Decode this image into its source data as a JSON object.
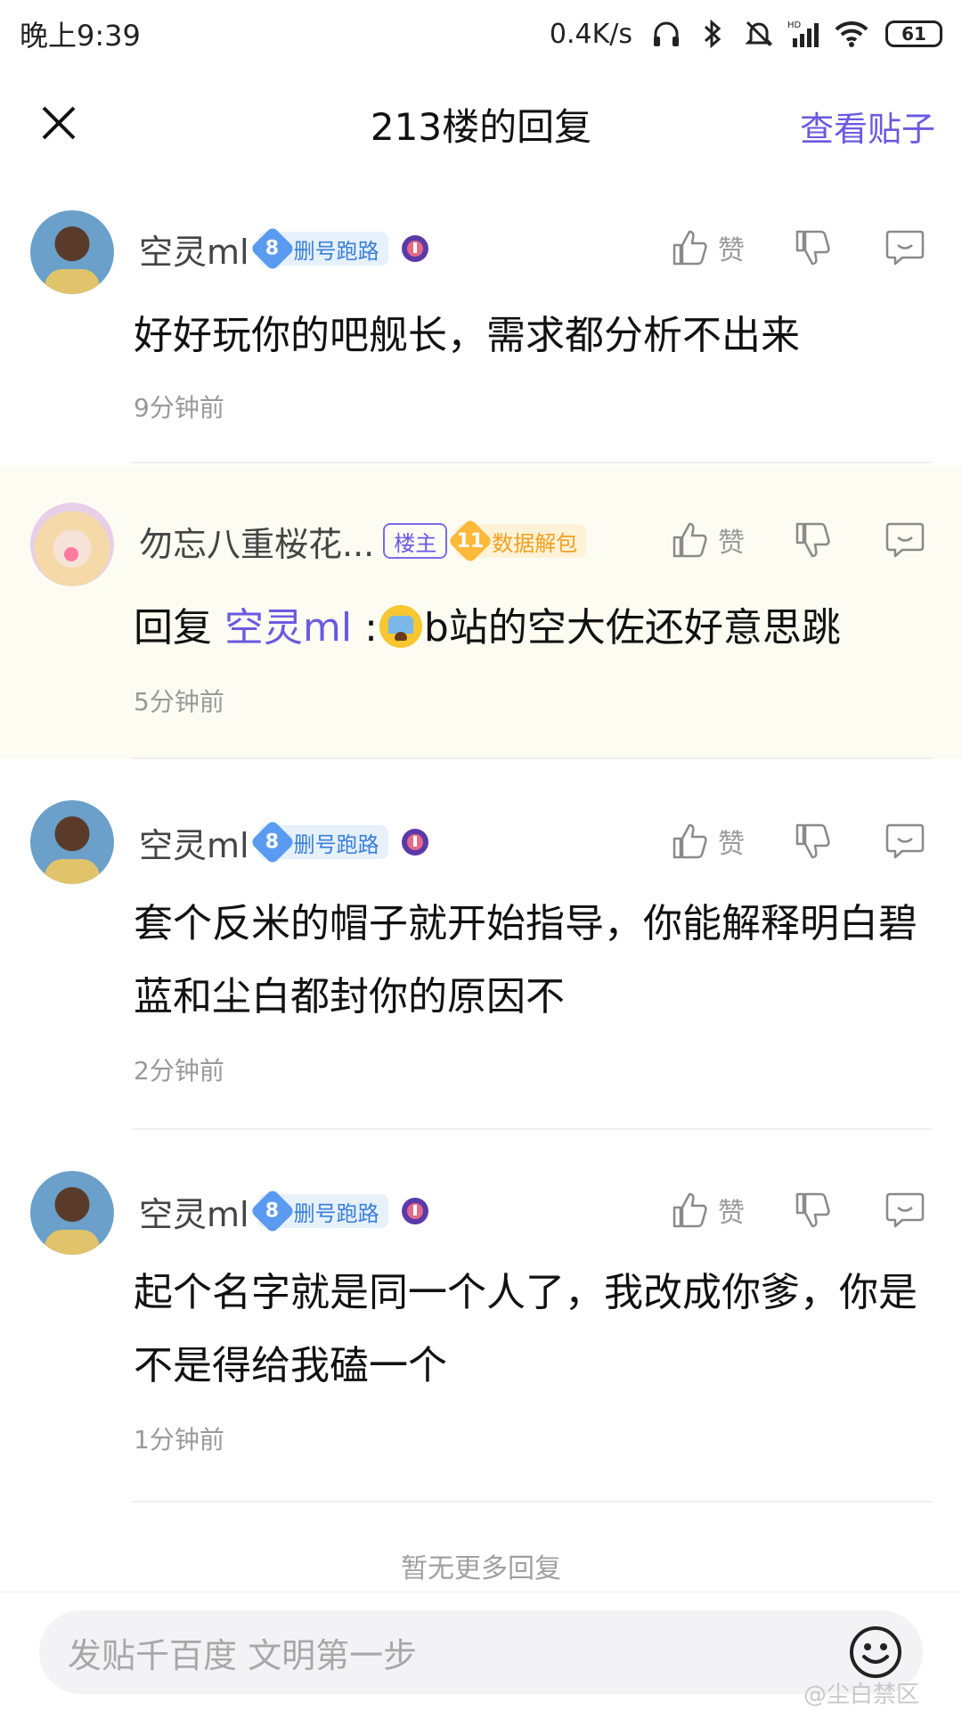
{
  "status_bar": {
    "time": "晚上9:39",
    "net_speed": "0.4K/s",
    "battery": "61",
    "icons": [
      "headphones-icon",
      "bluetooth-icon",
      "mute-icon",
      "hd-signal-icon",
      "wifi-icon",
      "battery-icon"
    ]
  },
  "header": {
    "title": "213楼的回复",
    "link": "查看贴子",
    "close_icon": "close-icon"
  },
  "colors": {
    "accent": "#6a5ae0",
    "level_blue": "#5a9af1",
    "level_gold": "#ffb93a",
    "highlight_bg": "#fdfcf3"
  },
  "replies": [
    {
      "username": "空灵ml",
      "level": "8",
      "badge": "删号跑路",
      "content": "好好玩你的吧舰长，需求都分析不出来",
      "time": "9分钟前",
      "like_label": "赞"
    },
    {
      "username": "勿忘八重桜花...",
      "owner_tag": "楼主",
      "level": "11",
      "badge": "数据解包",
      "reply_prefix": "回复 ",
      "mention": "空灵ml",
      "content_after": " :",
      "content_rest": "b站的空大佐还好意思跳",
      "time": "5分钟前",
      "like_label": "赞"
    },
    {
      "username": "空灵ml",
      "level": "8",
      "badge": "删号跑路",
      "content": "套个反米的帽子就开始指导，你能解释明白碧蓝和尘白都封你的原因不",
      "time": "2分钟前",
      "like_label": "赞"
    },
    {
      "username": "空灵ml",
      "level": "8",
      "badge": "删号跑路",
      "content": "起个名字就是同一个人了，我改成你爹，你是不是得给我磕一个",
      "time": "1分钟前",
      "like_label": "赞"
    }
  ],
  "no_more": "暂无更多回复",
  "input": {
    "placeholder": "发贴千百度 文明第一步"
  },
  "watermark": "@尘白禁区"
}
